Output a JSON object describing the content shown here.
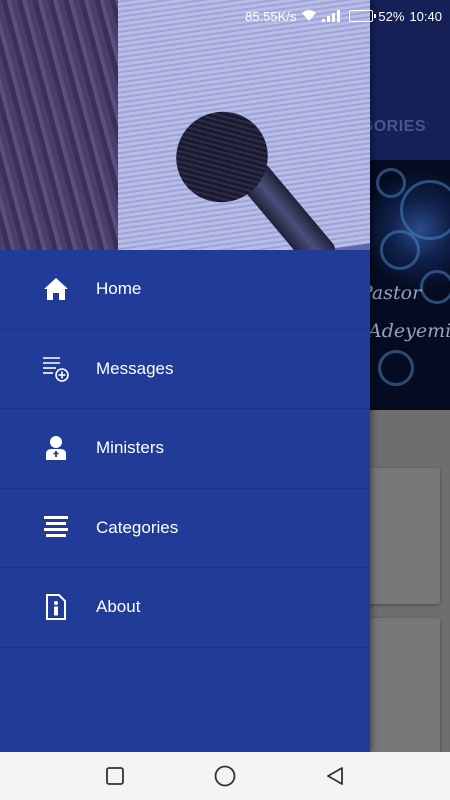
{
  "status_bar": {
    "network_speed": "85.55K/s",
    "battery_percent": "52%",
    "battery_level": 0.52,
    "time": "10:40"
  },
  "background_app": {
    "tab_label": "GORIES",
    "banner_text_line1": "Pastor",
    "banner_text_line2": "Adeyemi"
  },
  "drawer": {
    "header_image": "bible-and-microphone",
    "menu": [
      {
        "label": "Home",
        "icon": "home-icon"
      },
      {
        "label": "Messages",
        "icon": "messages-add-icon"
      },
      {
        "label": "Ministers",
        "icon": "minister-icon"
      },
      {
        "label": "Categories",
        "icon": "categories-icon"
      },
      {
        "label": "About",
        "icon": "about-icon"
      }
    ]
  },
  "navigation_bar": {
    "buttons": [
      "recents-button",
      "home-button",
      "back-button"
    ]
  },
  "colors": {
    "drawer_background": "#213c98",
    "app_topbar": "#152057",
    "navbar_background": "#f4f4f4"
  }
}
